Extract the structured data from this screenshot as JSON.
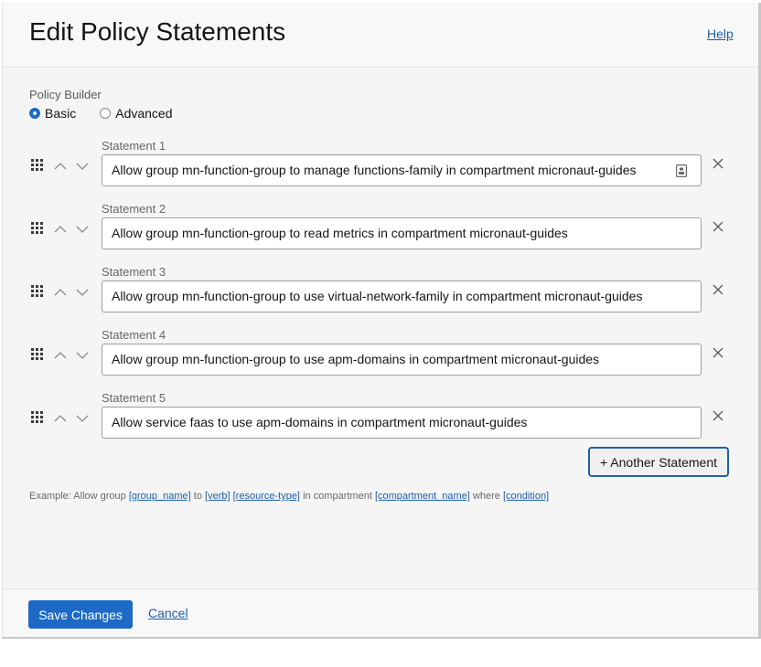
{
  "header": {
    "title": "Edit Policy Statements",
    "help": "Help"
  },
  "builder": {
    "label": "Policy Builder",
    "options": [
      {
        "label": "Basic",
        "checked": true
      },
      {
        "label": "Advanced",
        "checked": false
      }
    ]
  },
  "statements": [
    {
      "label": "Statement 1",
      "value": "Allow group mn-function-group to manage functions-family in compartment micronaut-guides"
    },
    {
      "label": "Statement 2",
      "value": "Allow group mn-function-group to read metrics in compartment micronaut-guides"
    },
    {
      "label": "Statement 3",
      "value": "Allow group mn-function-group to use virtual-network-family in compartment micronaut-guides"
    },
    {
      "label": "Statement 4",
      "value": "Allow group mn-function-group to use apm-domains in compartment micronaut-guides"
    },
    {
      "label": "Statement 5",
      "value": "Allow service faas to use apm-domains in compartment micronaut-guides"
    }
  ],
  "add_statement": "+ Another Statement",
  "example": {
    "prefix": "Example: Allow group",
    "group": "[group_name]",
    "to": "to",
    "verb": "[verb]",
    "resource": "[resource-type]",
    "in_compartment": "in compartment",
    "compartment": "[compartment_name]",
    "where": "where",
    "condition": "[condition]"
  },
  "footer": {
    "save": "Save Changes",
    "cancel": "Cancel"
  },
  "icons": {
    "drag": "drag-handle-icon",
    "up": "chevron-up-icon",
    "down": "chevron-down-icon",
    "remove": "close-icon",
    "assist": "clipboard-icon"
  },
  "colors": {
    "accent": "#1c6ac5",
    "link": "#1f5ea8"
  }
}
